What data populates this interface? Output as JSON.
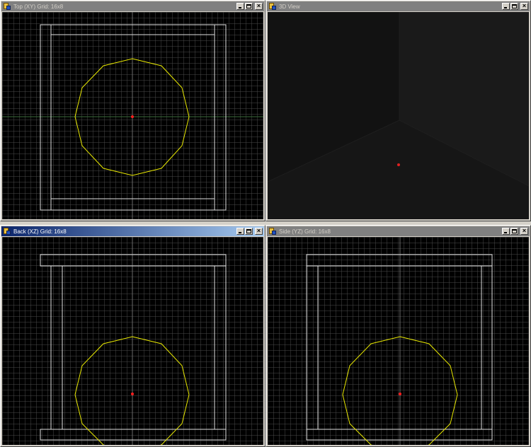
{
  "windows": {
    "top": {
      "title": "Top (XY) Grid: 16x8",
      "active": false
    },
    "view3d": {
      "title": "3D View",
      "active": false
    },
    "back": {
      "title": "Back (XZ) Grid: 16x8",
      "active": true
    },
    "side": {
      "title": "Side (YZ) Grid: 16x8",
      "active": false
    }
  },
  "colors": {
    "grid": "#5a5a5a",
    "brush_outline": "#e0e0e0",
    "selection_outline": "#e8e800",
    "origin_marker": "#ff2020",
    "active_title": "#0a246a",
    "inactive_title": "#808080"
  },
  "icons": [
    "app-icon",
    "minimize-icon",
    "maximize-icon",
    "close-icon"
  ]
}
